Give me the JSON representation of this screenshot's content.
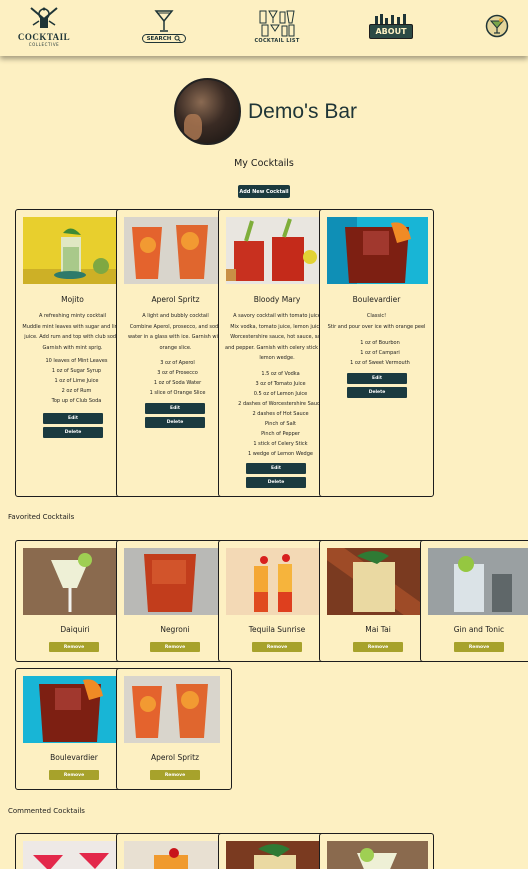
{
  "nav": {
    "logo": {
      "title": "COCKTAIL",
      "subtitle": "COLLECTIVE"
    },
    "search": {
      "label": "SEARCH"
    },
    "cocktail_list": {
      "label": "COCKTAIL LIST"
    },
    "about": {
      "label": "ABOUT"
    }
  },
  "profile": {
    "bar_name": "Demo's Bar"
  },
  "my_cocktails": {
    "title": "My Cocktails",
    "add_label": "Add New Cocktail",
    "cards": [
      {
        "name": "Mojito",
        "desc_lines": [
          "A refreshing minty cocktail",
          "Muddle mint leaves with sugar and lime",
          "juice. Add rum and top with club soda.",
          "Garnish with mint sprig."
        ],
        "ingredients": [
          "10 leaves of Mint Leaves",
          "1 oz of Sugar Syrup",
          "1 oz of Lime Juice",
          "2 oz of Rum",
          "Top up of Club Soda"
        ],
        "edit": "Edit",
        "delete": "Delete"
      },
      {
        "name": "Aperol Spritz",
        "desc_lines": [
          "A light and bubbly cocktail",
          "Combine Aperol, prosecco, and soda",
          "water in a glass with ice. Garnish with",
          "orange slice."
        ],
        "ingredients": [
          "3 oz of Aperol",
          "3 oz of Prosecco",
          "1 oz of Soda Water",
          "1 slice of Orange Slice"
        ],
        "edit": "Edit",
        "delete": "Delete"
      },
      {
        "name": "Bloody Mary",
        "desc_lines": [
          "A savory cocktail with tomato juice",
          "Mix vodka, tomato juice, lemon juice,",
          "Worcestershire sauce, hot sauce, salt",
          "and pepper. Garnish with celery stick and",
          "lemon wedge."
        ],
        "ingredients": [
          "1.5 oz of Vodka",
          "3 oz of Tomato Juice",
          "0.5 oz of Lemon Juice",
          "2 dashes of Worcestershire Sauce",
          "2 dashes of Hot Sauce",
          "Pinch of Salt",
          "Pinch of Pepper",
          "1 stick of Celery Stick",
          "1 wedge of Lemon Wedge"
        ],
        "edit": "Edit",
        "delete": "Delete"
      },
      {
        "name": "Boulevardier",
        "desc_lines": [
          "Classic!",
          "Stir and pour over ice with orange peel"
        ],
        "ingredients": [
          "1 oz of Bourbon",
          "1 oz of Campari",
          "1 oz of Sweet Vermouth"
        ],
        "edit": "Edit",
        "delete": "Delete"
      }
    ]
  },
  "favorited": {
    "title": "Favorited Cocktails",
    "remove_label": "Remove",
    "cards": [
      {
        "name": "Daiquiri"
      },
      {
        "name": "Negroni"
      },
      {
        "name": "Tequila Sunrise"
      },
      {
        "name": "Mai Tai"
      },
      {
        "name": "Gin and Tonic"
      },
      {
        "name": "Boulevardier"
      },
      {
        "name": "Aperol Spritz"
      }
    ]
  },
  "commented": {
    "title": "Commented Cocktails"
  }
}
